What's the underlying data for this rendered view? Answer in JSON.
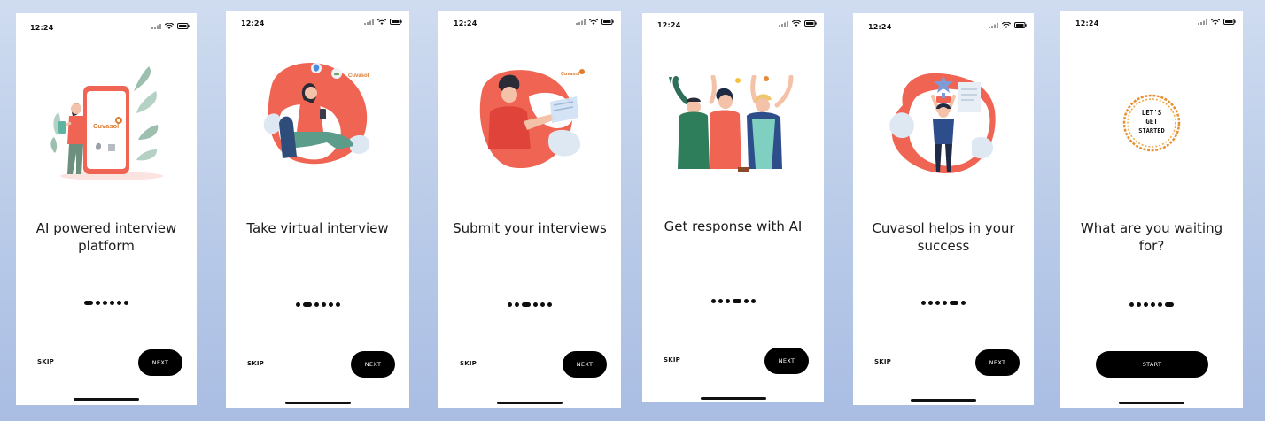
{
  "status_bar": {
    "time": "12:24"
  },
  "screens": [
    {
      "title": "AI powered interview platform",
      "secondary_button": "SKIP",
      "primary_button": "NEXT",
      "brand": "Cuvasol",
      "active_dot": 1,
      "total_dots": 6
    },
    {
      "title": "Take virtual interview",
      "secondary_button": "SKIP",
      "primary_button": "NEXT",
      "brand": "Cuvasol",
      "active_dot": 2,
      "total_dots": 6
    },
    {
      "title": "Submit your interviews",
      "secondary_button": "SKIP",
      "primary_button": "NEXT",
      "brand": "Cuvasol",
      "active_dot": 3,
      "total_dots": 6
    },
    {
      "title": "Get response with AI",
      "secondary_button": "SKIP",
      "primary_button": "NEXT",
      "active_dot": 4,
      "total_dots": 6
    },
    {
      "title": "Cuvasol helps in your success",
      "secondary_button": "SKIP",
      "primary_button": "NEXT",
      "active_dot": 5,
      "total_dots": 6
    },
    {
      "title": "What are you waiting for?",
      "primary_button": "START",
      "badge": [
        "LET'S",
        "GET",
        "STARTED"
      ],
      "active_dot": 6,
      "total_dots": 6
    }
  ],
  "colors": {
    "accent": "#ef6452",
    "ink": "#000000",
    "brand_orange": "#e07b2c"
  }
}
